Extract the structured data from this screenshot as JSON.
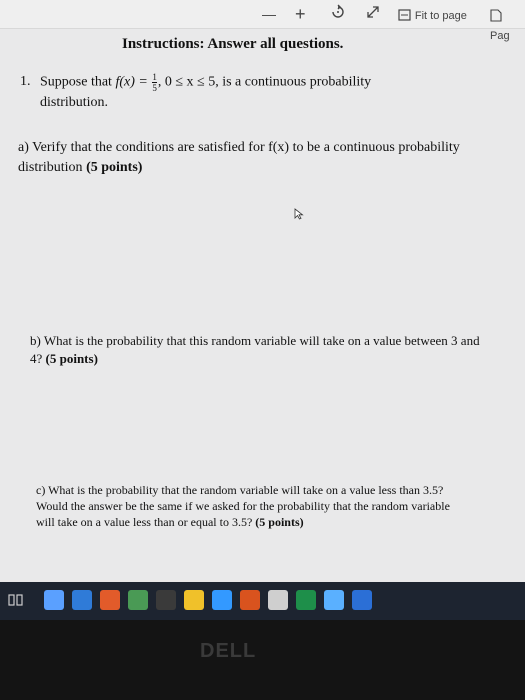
{
  "toolbar": {
    "zoom_out": "—",
    "zoom_in": "+",
    "fit_to_page": "Fit to page",
    "page_label": "Pag"
  },
  "document": {
    "instructions": "Instructions: Answer all questions.",
    "q1": {
      "number": "1.",
      "lead": "Suppose that ",
      "func": "f(x) = ",
      "frac_num": "1",
      "frac_den": "5",
      "range": ", 0 ≤ x ≤ 5, is a continuous probability",
      "line2": "distribution."
    },
    "qa": {
      "text": "a) Verify that the conditions are satisfied for f(x) to be a continuous probability distribution ",
      "points": "(5 points)"
    },
    "qb": {
      "text": "b) What is the probability that this random variable will take on a value between 3 and 4? ",
      "points": "(5 points)"
    },
    "qc": {
      "text": "c) What is the probability that the random variable will take on a value less than 3.5? Would the answer be the same if we asked for the probability that the random variable will take on a value less than or equal to 3.5? ",
      "points": "(5 points)"
    }
  },
  "taskbar": {
    "colors": [
      "#5aa0ff",
      "#2f7bd8",
      "#e25b2a",
      "#4a9a55",
      "#3a3a3a",
      "#f0c12a",
      "#3399ff",
      "#d9531e",
      "#cfcfcf",
      "#1e8f4a",
      "#5ab0ff",
      "#2b6fd6"
    ]
  },
  "bezel": {
    "brand": "DELL"
  }
}
